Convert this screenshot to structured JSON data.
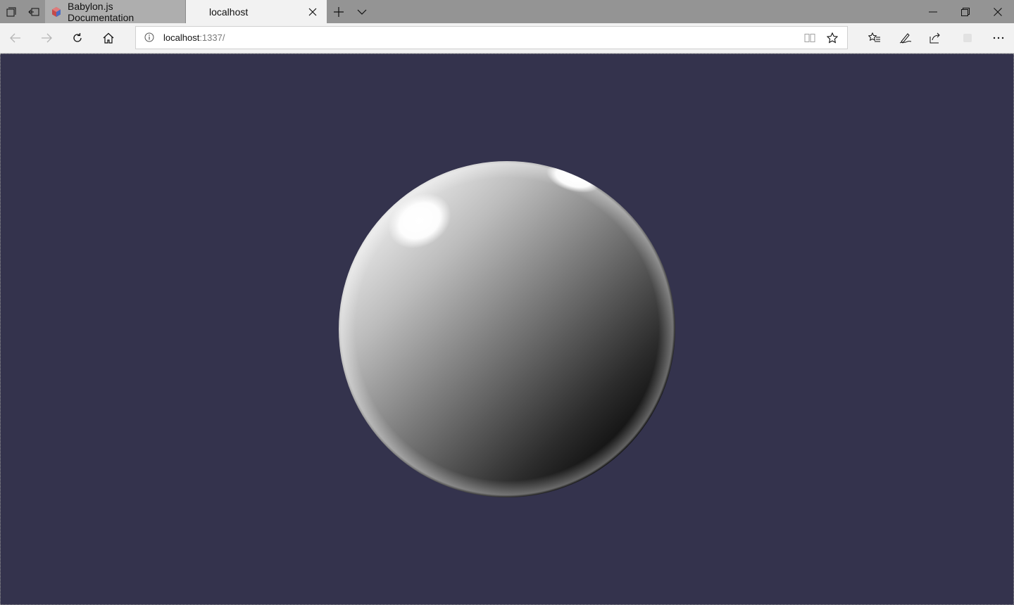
{
  "browser": {
    "tabs": [
      {
        "label": "Babylon.js Documentation",
        "active": false,
        "icon": "babylon-favicon"
      },
      {
        "label": "localhost",
        "active": true
      }
    ],
    "address": {
      "host": "localhost",
      "path": ":1337/"
    }
  },
  "scene": {
    "background_color": "#34334d",
    "object": "sphere"
  }
}
